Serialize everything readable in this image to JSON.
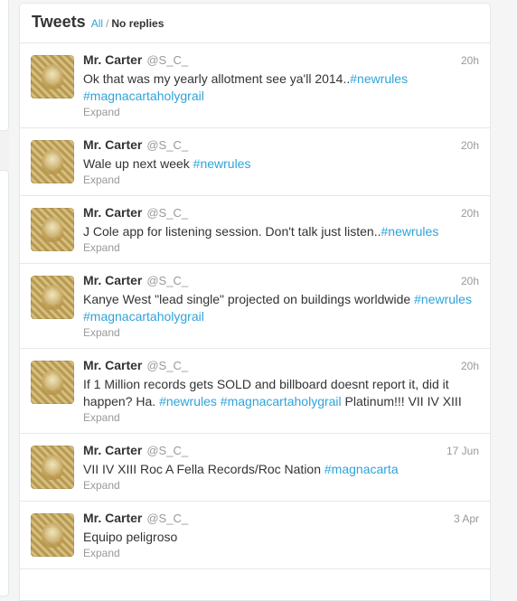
{
  "header": {
    "title": "Tweets",
    "filter_all": "All",
    "filter_separator": "/",
    "filter_noreplies": "No replies"
  },
  "colors": {
    "link": "#2fa3d8",
    "text": "#333333",
    "muted": "#999999"
  },
  "tweets": [
    {
      "name": "Mr. Carter",
      "handle": "@S_C_",
      "time": "20h",
      "expand": "Expand",
      "segments": [
        {
          "text": "Ok that was my yearly allotment see ya'll 2014..",
          "hashtag": false
        },
        {
          "text": "#newrules",
          "hashtag": true
        },
        {
          "text": " ",
          "hashtag": false
        },
        {
          "text": "#magnacartaholygrail",
          "hashtag": true
        }
      ]
    },
    {
      "name": "Mr. Carter",
      "handle": "@S_C_",
      "time": "20h",
      "expand": "Expand",
      "segments": [
        {
          "text": "Wale up next week ",
          "hashtag": false
        },
        {
          "text": "#newrules",
          "hashtag": true
        }
      ]
    },
    {
      "name": "Mr. Carter",
      "handle": "@S_C_",
      "time": "20h",
      "expand": "Expand",
      "segments": [
        {
          "text": "J Cole app for listening session. Don't talk just listen..",
          "hashtag": false
        },
        {
          "text": "#newrules",
          "hashtag": true
        }
      ]
    },
    {
      "name": "Mr. Carter",
      "handle": "@S_C_",
      "time": "20h",
      "expand": "Expand",
      "segments": [
        {
          "text": "Kanye West \"lead single\" projected on buildings worldwide ",
          "hashtag": false
        },
        {
          "text": "#newrules",
          "hashtag": true
        },
        {
          "text": " ",
          "hashtag": false
        },
        {
          "text": "#magnacartaholygrail",
          "hashtag": true
        }
      ]
    },
    {
      "name": "Mr. Carter",
      "handle": "@S_C_",
      "time": "20h",
      "expand": "Expand",
      "segments": [
        {
          "text": "If 1 Million records gets SOLD and billboard doesnt report it, did it happen? Ha. ",
          "hashtag": false
        },
        {
          "text": "#newrules",
          "hashtag": true
        },
        {
          "text": " ",
          "hashtag": false
        },
        {
          "text": "#magnacartaholygrail",
          "hashtag": true
        },
        {
          "text": " Platinum!!! VII IV XIII",
          "hashtag": false
        }
      ]
    },
    {
      "name": "Mr. Carter",
      "handle": "@S_C_",
      "time": "17 Jun",
      "expand": "Expand",
      "segments": [
        {
          "text": "VII IV XIII Roc A Fella Records/Roc Nation ",
          "hashtag": false
        },
        {
          "text": "#magnacarta",
          "hashtag": true
        }
      ]
    },
    {
      "name": "Mr. Carter",
      "handle": "@S_C_",
      "time": "3 Apr",
      "expand": "Expand",
      "segments": [
        {
          "text": "Equipo peligroso",
          "hashtag": false
        }
      ]
    }
  ]
}
